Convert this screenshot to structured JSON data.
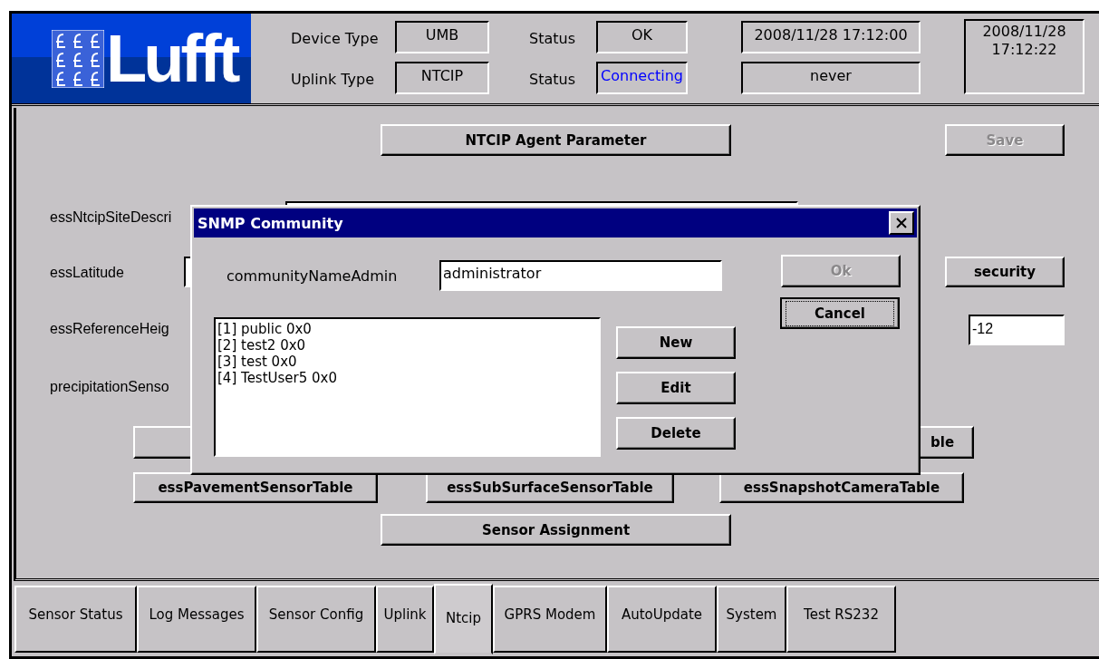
{
  "header": {
    "logo_text": "Lufft",
    "types": [
      {
        "label": "Device Type",
        "value": "UMB"
      },
      {
        "label": "Uplink Type",
        "value": "NTCIP"
      }
    ],
    "statuses": [
      {
        "label": "Status",
        "value": "OK",
        "color": "#000000"
      },
      {
        "label": "Status",
        "value": "Connecting",
        "color": "#0000ff"
      }
    ],
    "timestamps": [
      "2008/11/28 17:12:00",
      "never"
    ],
    "clock": "2008/11/28 17:12:22"
  },
  "panel": {
    "agent_button": "NTCIP Agent Parameter",
    "save_button": {
      "label": "Save",
      "disabled": true
    },
    "fields": [
      {
        "label": "essNtcipSiteDescri"
      },
      {
        "label": "essLatitude"
      },
      {
        "label": "essReferenceHeig"
      },
      {
        "label": "precipitationSenso"
      }
    ],
    "security_button": "security",
    "reference_value": "-12",
    "partial_button": "ble",
    "table_buttons": [
      "essPavementSensorTable",
      "essSubSurfaceSensorTable",
      "essSnapshotCameraTable"
    ],
    "assignment_button": "Sensor Assignment"
  },
  "dialog": {
    "title": "SNMP Community",
    "field_label": "communityNameAdmin",
    "field_value": "administrator",
    "communities": [
      "[1] public 0x0",
      "[2] test2 0x0",
      "[3] test 0x0",
      "[4] TestUser5 0x0"
    ],
    "actions": [
      "New",
      "Edit",
      "Delete"
    ],
    "ok_button": {
      "label": "Ok",
      "disabled": true
    },
    "cancel_button": {
      "label": "Cancel",
      "focused": true
    }
  },
  "tabs": [
    {
      "label": "Sensor Status",
      "selected": false
    },
    {
      "label": "Log Messages",
      "selected": false
    },
    {
      "label": "Sensor Config",
      "selected": false
    },
    {
      "label": "Uplink",
      "selected": false
    },
    {
      "label": "Ntcip",
      "selected": true
    },
    {
      "label": "GPRS Modem",
      "selected": false
    },
    {
      "label": "AutoUpdate",
      "selected": false
    },
    {
      "label": "System",
      "selected": false
    },
    {
      "label": "Test RS232",
      "selected": false
    }
  ]
}
